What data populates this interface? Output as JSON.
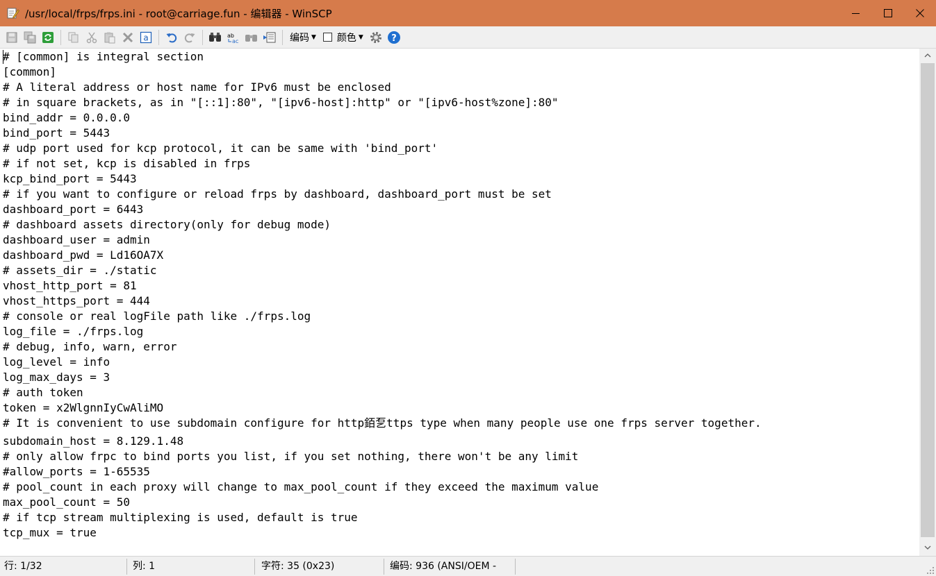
{
  "window": {
    "title": "/usr/local/frps/frps.ini - root@carriage.fun - 编辑器 - WinSCP",
    "titlebar_color": "#d67b4b"
  },
  "toolbar": {
    "icons": [
      "save-icon",
      "save-all-icon",
      "reload-icon",
      "copy-icon",
      "cut-icon",
      "paste-icon",
      "delete-icon",
      "select-all-icon",
      "undo-icon",
      "redo-icon",
      "find-icon",
      "replace-icon",
      "find-next-icon",
      "goto-line-icon",
      "settings-icon",
      "help-icon"
    ],
    "encoding_label": "编码",
    "color_label": "颜色"
  },
  "editor": {
    "lines": [
      "# [common] is integral section",
      "[common]",
      "# A literal address or host name for IPv6 must be enclosed",
      "# in square brackets, as in \"[::1]:80\", \"[ipv6-host]:http\" or \"[ipv6-host%zone]:80\"",
      "bind_addr = 0.0.0.0",
      "bind_port = 5443",
      "# udp port used for kcp protocol, it can be same with 'bind_port'",
      "# if not set, kcp is disabled in frps",
      "kcp_bind_port = 5443",
      "# if you want to configure or reload frps by dashboard, dashboard_port must be set",
      "dashboard_port = 6443",
      "# dashboard assets directory(only for debug mode)",
      "dashboard_user = admin",
      "dashboard_pwd = Ld16OA7X",
      "# assets_dir = ./static",
      "vhost_http_port = 81",
      "vhost_https_port = 444",
      "# console or real logFile path like ./frps.log",
      "log_file = ./frps.log",
      "# debug, info, warn, error",
      "log_level = info",
      "log_max_days = 3",
      "# auth token",
      "token = x2WlgnnIyCwAliMO",
      "# It is convenient to use subdomain configure for http銆乭ttps type when many people use one frps server together.",
      "subdomain_host = 8.129.1.48",
      "# only allow frpc to bind ports you list, if you set nothing, there won't be any limit",
      "#allow_ports = 1-65535",
      "# pool_count in each proxy will change to max_pool_count if they exceed the maximum value",
      "max_pool_count = 50",
      "# if tcp stream multiplexing is used, default is true",
      "tcp_mux = true"
    ]
  },
  "status": {
    "line": "行: 1/32",
    "column": "列: 1",
    "character": "字符: 35 (0x23)",
    "encoding": "编码: 936  (ANSI/OEM -"
  }
}
